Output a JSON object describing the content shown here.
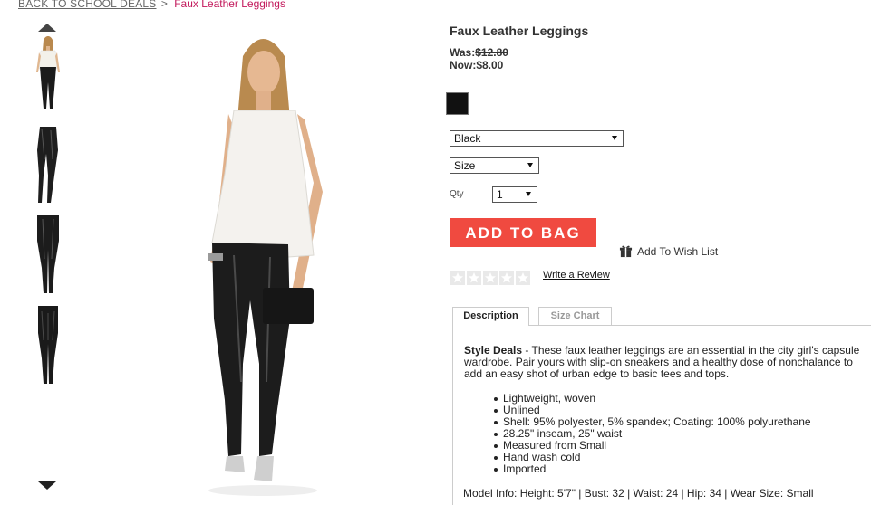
{
  "breadcrumb": {
    "back_label": "BACK TO SCHOOL DEALS",
    "separator": ">",
    "current": "Faux Leather Leggings"
  },
  "gallery": {
    "thumbnails": [
      {
        "name": "thumbnail-full-outfit"
      },
      {
        "name": "thumbnail-leggings-side"
      },
      {
        "name": "thumbnail-leggings-front"
      },
      {
        "name": "thumbnail-leggings-back"
      }
    ]
  },
  "product": {
    "title": "Faux Leather Leggings",
    "was_label": "Was:",
    "was_price": "$12.80",
    "now_label": "Now:",
    "now_price": "$8.00",
    "swatch_color": "#111111"
  },
  "options": {
    "color_selected": "Black",
    "size_selected": "Size",
    "qty_label": "Qty",
    "qty_selected": "1"
  },
  "actions": {
    "add_to_bag": "ADD TO BAG",
    "wish_list": "Add To Wish List",
    "write_review": "Write a Review"
  },
  "tabs": {
    "description": "Description",
    "size_chart": "Size Chart"
  },
  "description": {
    "lead": "Style Deals",
    "text": " - These faux leather leggings are an essential in the city girl's capsule wardrobe. Pair yours with slip-on sneakers and a healthy dose of nonchalance to add an easy shot of urban edge to basic tees and tops.",
    "bullets": [
      "Lightweight, woven",
      "Unlined",
      "Shell: 95% polyester, 5% spandex; Coating: 100% polyurethane",
      "28.25\" inseam, 25\" waist",
      "Measured from Small",
      "Hand wash cold",
      "Imported"
    ],
    "model_info": "Model Info: Height: 5'7\" | Bust: 32 | Waist: 24 | Hip: 34 | Wear Size: Small"
  },
  "colors": {
    "add_button": "#f04a40",
    "breadcrumb_current": "#c2185b"
  }
}
